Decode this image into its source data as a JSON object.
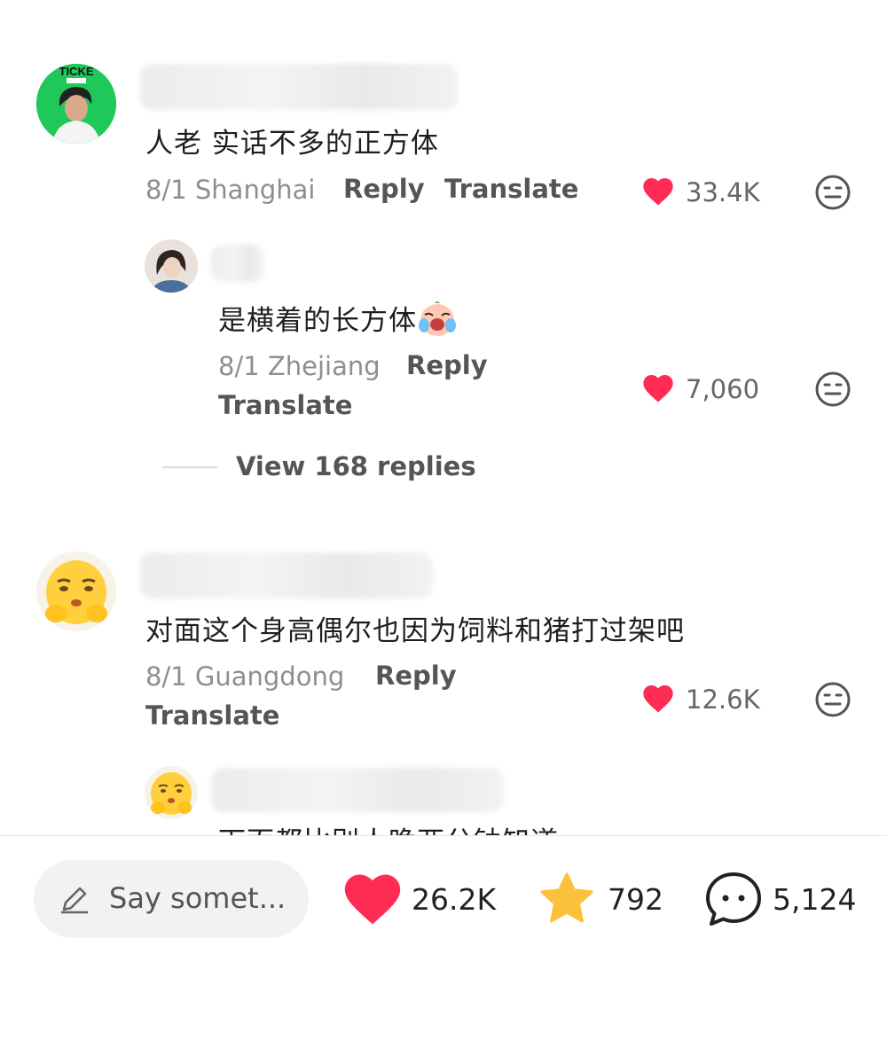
{
  "comments": [
    {
      "text": "人老 实话不多的正方体",
      "date": "8/1",
      "location": "Shanghai",
      "reply_label": "Reply",
      "translate_label": "Translate",
      "likes": "33.4K",
      "avatar_badge": "TICKE",
      "reply": {
        "text": "是横着的长方体",
        "date": "8/1",
        "location": "Zhejiang",
        "reply_label": "Reply",
        "translate_label": "Translate",
        "likes": "7,060"
      },
      "view_replies": "View 168 replies"
    },
    {
      "text": "对面这个身高偶尔也因为饲料和猪打过架吧",
      "date": "8/1",
      "location": "Guangdong",
      "reply_label": "Reply",
      "translate_label": "Translate",
      "likes": "12.6K",
      "reply": {
        "text": "下面都比别人晚两分钟知道"
      }
    }
  ],
  "bottom_bar": {
    "input_placeholder": "Say somet...",
    "likes": "26.2K",
    "favorites": "792",
    "comments": "5,124"
  },
  "colors": {
    "heart": "#fe2c55",
    "star": "#fcc13b",
    "avatar_green": "#1ec95a"
  }
}
